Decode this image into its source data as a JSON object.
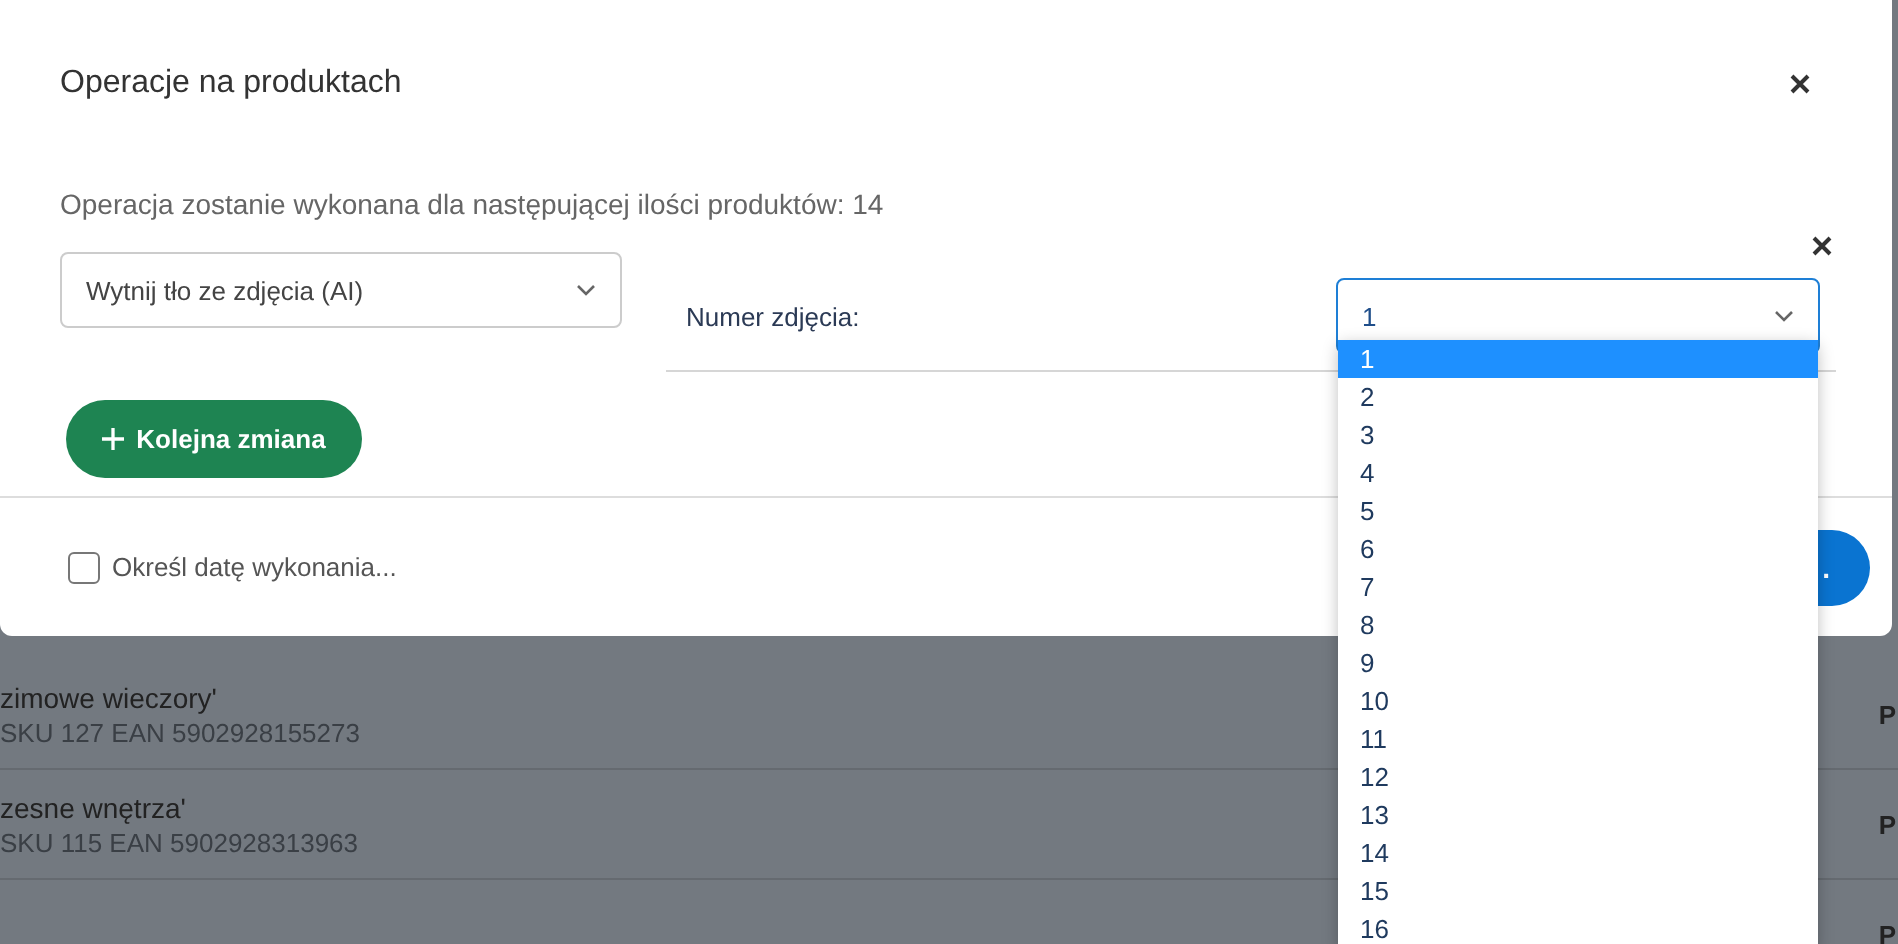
{
  "dialog": {
    "title": "Operacje na produktach",
    "info": "Operacja zostanie wykonana dla następującej ilości produktów: 14",
    "operation_select": {
      "value": "Wytnij tło ze zdjęcia (AI)"
    },
    "parameter": {
      "label": "Numer zdjęcia:",
      "value": "1",
      "expanded": true,
      "options": [
        {
          "label": "1",
          "selected": true
        },
        {
          "label": "2",
          "selected": false
        },
        {
          "label": "3",
          "selected": false
        },
        {
          "label": "4",
          "selected": false
        },
        {
          "label": "5",
          "selected": false
        },
        {
          "label": "6",
          "selected": false
        },
        {
          "label": "7",
          "selected": false
        },
        {
          "label": "8",
          "selected": false
        },
        {
          "label": "9",
          "selected": false
        },
        {
          "label": "10",
          "selected": false
        },
        {
          "label": "11",
          "selected": false
        },
        {
          "label": "12",
          "selected": false
        },
        {
          "label": "13",
          "selected": false
        },
        {
          "label": "14",
          "selected": false
        },
        {
          "label": "15",
          "selected": false
        },
        {
          "label": "16",
          "selected": false
        }
      ]
    },
    "add_button": "Kolejna zmiana",
    "schedule_checkbox": {
      "label": "Określ datę wykonania...",
      "checked": false
    },
    "submit_button": "."
  },
  "background_rows": [
    {
      "title": "zimowe wieczory'",
      "subtitle": "SKU 127 EAN 5902928155273",
      "column_2": "P"
    },
    {
      "title": "zesne wnętrza'",
      "subtitle": "SKU 115 EAN 5902928313963",
      "column_2": "P"
    },
    {
      "column_2": "P"
    }
  ]
}
